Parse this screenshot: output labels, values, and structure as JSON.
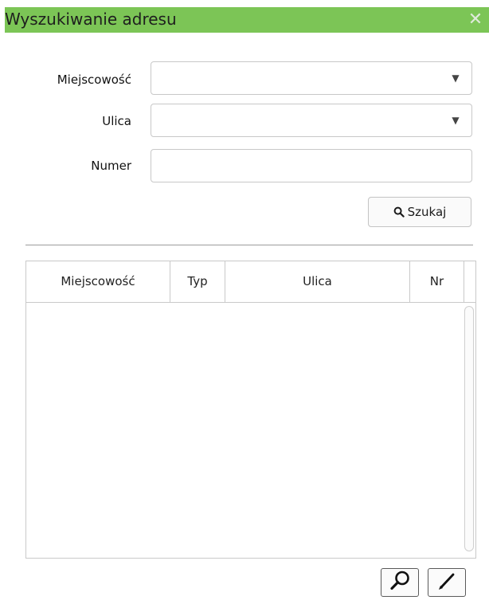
{
  "window": {
    "title": "Wyszukiwanie adresu",
    "close_icon": "close-icon",
    "titlebar_color": "#7cc556"
  },
  "form": {
    "miejscowosc": {
      "label": "Miejscowość",
      "value": "",
      "placeholder": ""
    },
    "ulica": {
      "label": "Ulica",
      "value": "",
      "placeholder": ""
    },
    "numer": {
      "label": "Numer",
      "value": "",
      "placeholder": ""
    },
    "search_button": {
      "label": "Szukaj",
      "icon": "search-icon"
    }
  },
  "grid": {
    "columns": [
      "Miejscowość",
      "Typ",
      "Ulica",
      "Nr"
    ],
    "rows": []
  },
  "toolbar": {
    "zoom_button_icon": "magnifier-icon",
    "edit_button_icon": "pencil-icon"
  }
}
